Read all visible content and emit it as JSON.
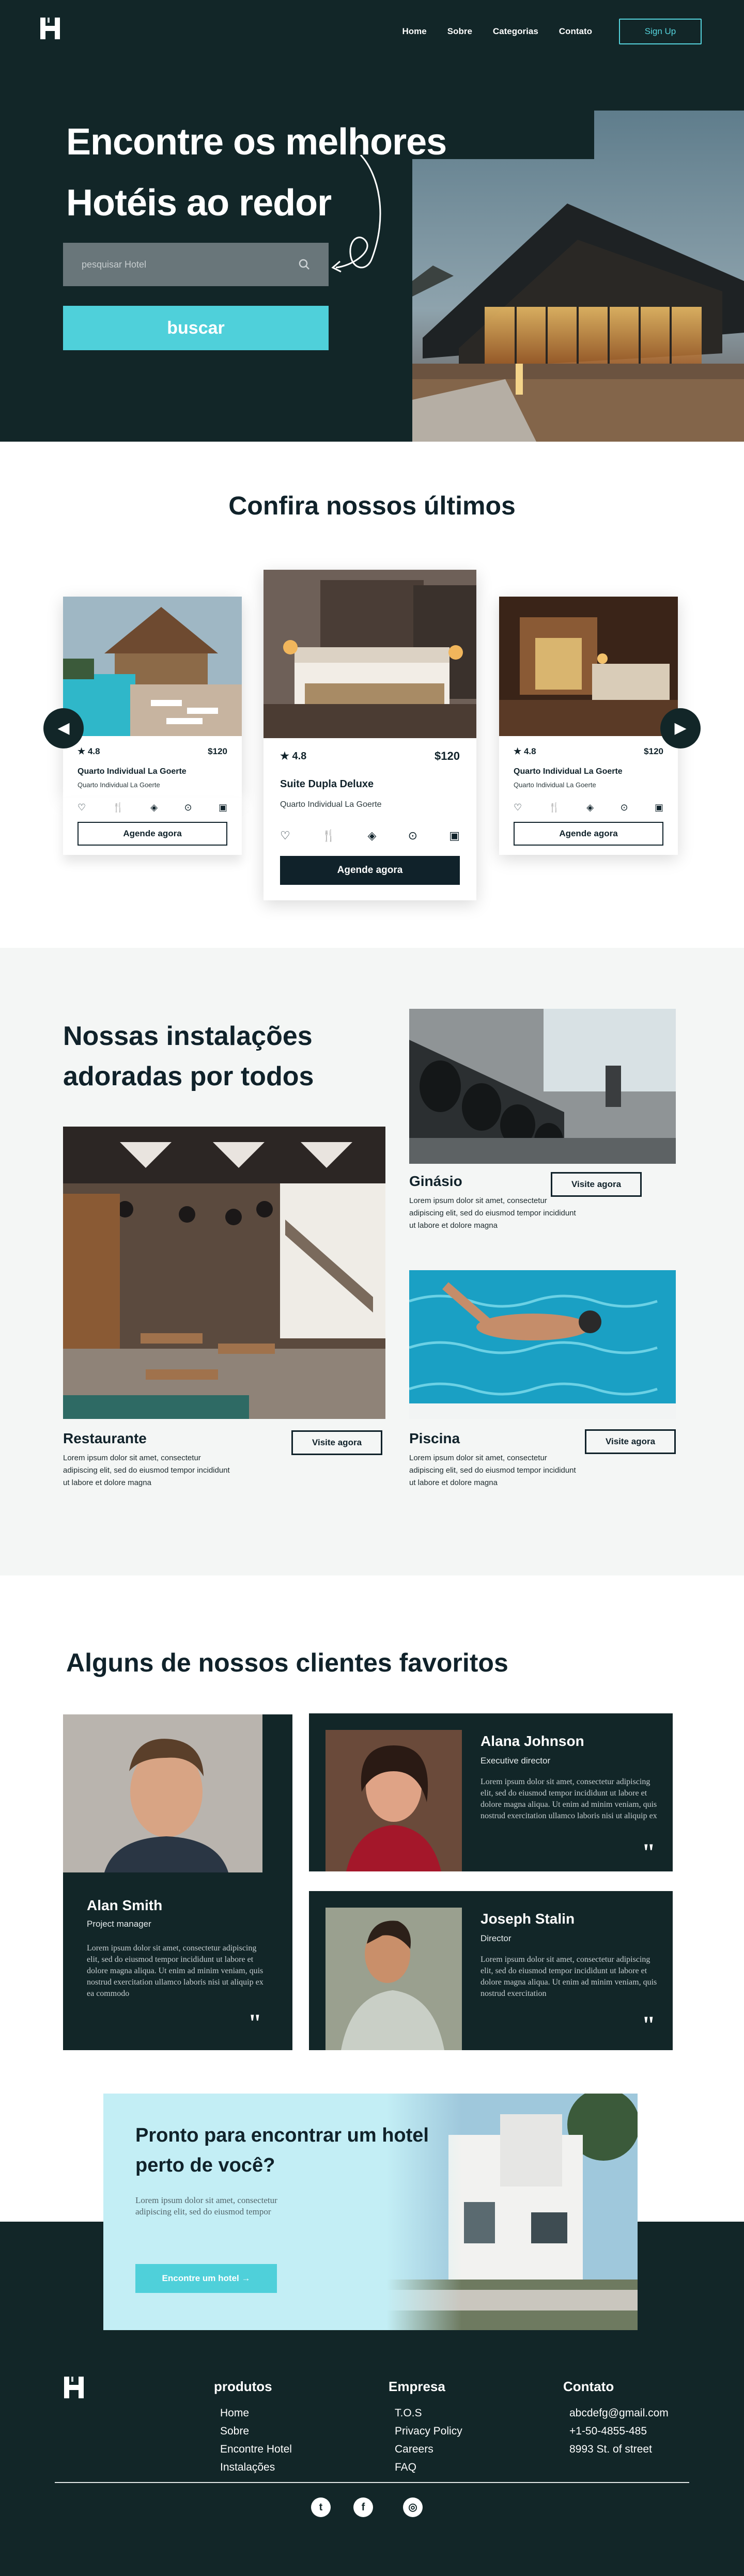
{
  "nav": {
    "items": [
      "Home",
      "Sobre",
      "Categorias",
      "Contato"
    ],
    "signup_label": "Sign Up"
  },
  "hero": {
    "title_line1": "Encontre os melhores",
    "title_line2": "Hotéis ao redor",
    "search_placeholder": "pesquisar Hotel",
    "search_button": "buscar"
  },
  "latest": {
    "title": "Confira nossos últimos",
    "cards": [
      {
        "rating": "4.8",
        "price": "$120",
        "name": "Quarto Individual La Goerte",
        "subtitle": "Quarto Individual La Goerte",
        "cta": "Agende agora"
      },
      {
        "rating": "4.8",
        "price": "$120",
        "name": "Suite Dupla Deluxe",
        "subtitle": "Quarto Individual La Goerte",
        "cta": "Agende agora"
      },
      {
        "rating": "4.8",
        "price": "$120",
        "name": "Quarto Individual La Goerte",
        "subtitle": "Quarto Individual La Goerte",
        "cta": "Agende agora"
      }
    ]
  },
  "facilities": {
    "title_line1": "Nossas instalações",
    "title_line2": "adoradas por todos",
    "items": [
      {
        "name": "Ginásio",
        "desc": "Lorem ipsum dolor sit amet, consectetur adipiscing elit, sed do eiusmod tempor incididunt ut labore et dolore magna",
        "cta": "Visite agora"
      },
      {
        "name": "Restaurante",
        "desc": "Lorem ipsum dolor sit amet, consectetur adipiscing elit, sed do eiusmod tempor incididunt ut labore et dolore magna",
        "cta": "Visite agora"
      },
      {
        "name": "Piscina",
        "desc": "Lorem ipsum dolor sit amet, consectetur adipiscing elit, sed do eiusmod tempor incididunt ut labore et dolore magna",
        "cta": "Visite agora"
      }
    ]
  },
  "testimonials": {
    "title": "Alguns de nossos clientes favoritos",
    "items": [
      {
        "name": "Alan Smith",
        "role": "Project manager",
        "text": "Lorem ipsum dolor sit amet, consectetur adipiscing elit, sed do eiusmod tempor incididunt ut labore et dolore magna aliqua. Ut enim ad minim veniam, quis nostrud exercitation ullamco laboris nisi ut aliquip ex ea commodo"
      },
      {
        "name": "Alana Johnson",
        "role": "Executive director",
        "text": "Lorem ipsum dolor sit amet, consectetur adipiscing elit, sed do eiusmod tempor incididunt ut labore et dolore magna aliqua. Ut enim ad minim veniam, quis nostrud exercitation ullamco laboris nisi ut aliquip ex"
      },
      {
        "name": "Joseph Stalin",
        "role": "Director",
        "text": "Lorem ipsum dolor sit amet, consectetur adipiscing elit, sed do eiusmod tempor incididunt ut labore et dolore magna aliqua. Ut enim ad minim veniam, quis nostrud exercitation"
      }
    ]
  },
  "cta": {
    "title_line1": "Pronto para encontrar um hotel",
    "title_line2": "perto de você?",
    "text_line1": "Lorem ipsum dolor sit amet, consectetur",
    "text_line2": "adipiscing elit, sed do eiusmod tempor",
    "button": "Encontre um hotel"
  },
  "footer": {
    "col1_title": "produtos",
    "col1_links": [
      "Home",
      "Sobre",
      "Encontre Hotel",
      "Instalações"
    ],
    "col2_title": "Empresa",
    "col2_links": [
      "T.O.S",
      "Privacy Policy",
      "Careers",
      "FAQ"
    ],
    "col3_title": "Contato",
    "col3_links": [
      "abcdefg@gmail.com",
      "+1-50-4855-485",
      "8993 St. of street"
    ]
  },
  "colors": {
    "dark": "#122628",
    "accent": "#4fd0da",
    "light_cta": "#c3eef5"
  }
}
